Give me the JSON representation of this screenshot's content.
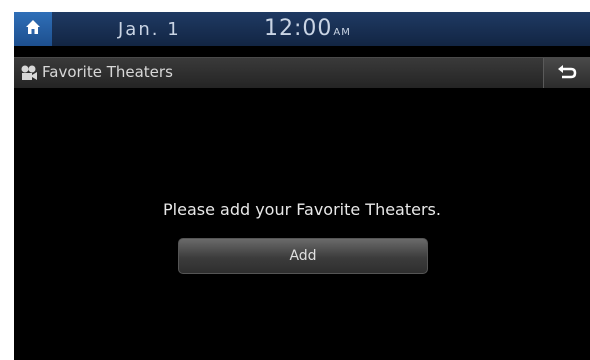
{
  "status_bar": {
    "home_icon": "home-icon",
    "date": "Jan. 1",
    "time": "12:00",
    "ampm": "AM"
  },
  "title_bar": {
    "icon": "theater-icon",
    "title": "Favorite Theaters",
    "back_icon": "back-icon"
  },
  "main": {
    "message": "Please add your Favorite Theaters.",
    "add_label": "Add"
  },
  "colors": {
    "status_bar": "#1a3155",
    "home_button": "#2a62a8",
    "background": "#000000"
  }
}
